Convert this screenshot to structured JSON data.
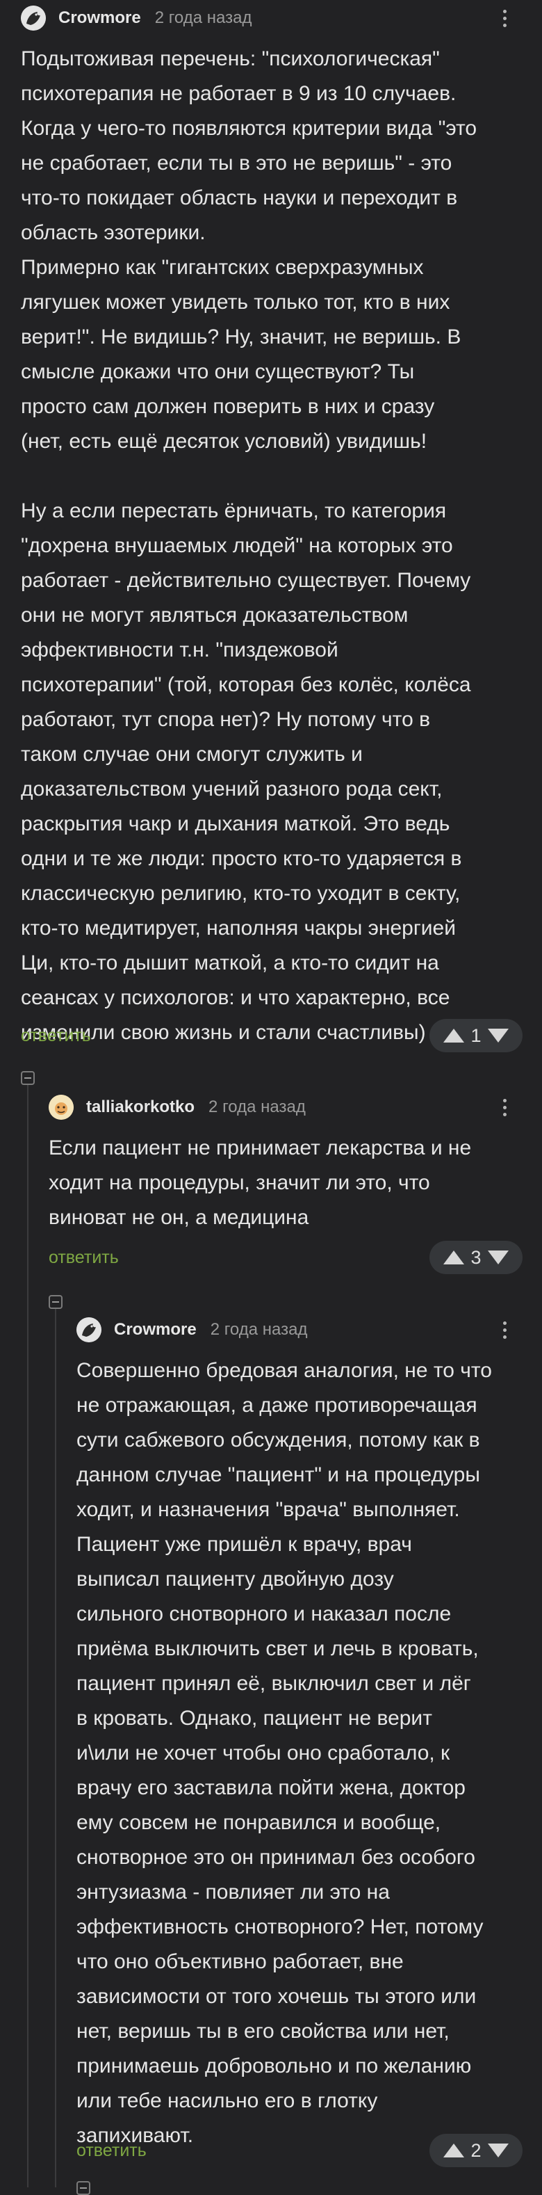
{
  "comments": [
    {
      "author": "Crowmore",
      "time": "2 года назад",
      "text": "Подытоживая перечень: \"психологическая\"\nпсихотерапия не работает в 9 из 10 случаев.\nКогда у чего-то появляются критерии вида \"это\nне сработает, если ты в это не веришь\" - это\nчто-то покидает область науки и переходит в\nобласть эзотерики.\nПримерно как \"гигантских сверхразумных\nлягушек может увидеть только тот, кто в них\nверит!\". Не видишь? Ну, значит, не веришь. В\nсмысле докажи что они существуют? Ты\nпросто сам должен поверить в них и сразу\n(нет, есть ещё десяток условий) увидишь!\n\nНу а если перестать ёрничать, то категория\n\"дохрена внушаемых людей\" на которых это\nработает - действительно существует. Почему\nони не могут являться доказательством\nэффективности т.н. \"пиздежовой\nпсихотерапии\" (той, которая без колёс, колёса\nработают, тут спора нет)? Ну потому что в\nтаком случае они смогут служить и\nдоказательством учений разного рода сект,\nраскрытия чакр и дыхания маткой. Это ведь\nодни и те же люди: просто кто-то ударяется в\nклассическую религию, кто-то уходит в секту,\nкто-то медитирует, наполняя чакры энергией\nЦи, кто-то дышит маткой, а кто-то сидит на\nсеансах у психологов: и что характерно, все\nизменили свою жизнь и стали счастливы)",
      "reply_label": "ответить",
      "score": "1"
    },
    {
      "author": "talliakorkotko",
      "time": "2 года назад",
      "text": "Если пациент не принимает лекарства и не\nходит на процедуры, значит ли это, что\nвиноват не он, а медицина",
      "reply_label": "ответить",
      "score": "3"
    },
    {
      "author": "Crowmore",
      "time": "2 года назад",
      "text": "Совершенно бредовая аналогия, не то что\nне отражающая, а даже противоречащая\nсути сабжевого обсуждения, потому как в\nданном случае \"пациент\" и на процедуры\nходит, и назначения \"врача\" выполняет.\nПациент уже пришёл к врачу, врач\nвыписал пациенту двойную дозу\nсильного снотворного и наказал после\nприёма выключить свет и лечь в кровать,\nпациент принял её, выключил свет и лёг\nв кровать. Однако, пациент не верит\nи\\или не хочет чтобы оно сработало, к\nврачу его заставила пойти жена, доктор\nему совсем не понравился и вообще,\nснотворное это он принимал без особого\nэнтузиазма - повлияет ли это на\nэффективность снотворного? Нет, потому\nчто оно объективно работает, вне\nзависимости от того хочешь ты этого или\nнет, веришь ты в его свойства или нет,\nпринимаешь добровольно и по желанию\nили тебе насильно его в глотку\nзапихивают.",
      "reply_label": "ответить",
      "score": "2"
    }
  ],
  "icons": {
    "more": "more-vertical-icon",
    "upvote": "upvote-arrow-icon",
    "downvote": "downvote-arrow-icon",
    "collapse": "collapse-thread-icon"
  },
  "colors": {
    "background": "#222224",
    "reply_link": "#7fa843",
    "vote_pill": "#35373a"
  }
}
